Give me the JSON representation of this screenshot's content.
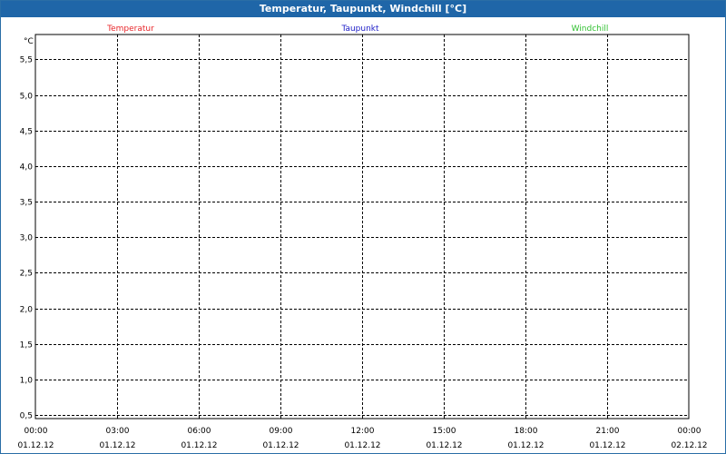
{
  "window": {
    "title": "Temperatur, Taupunkt, Windchill [°C]"
  },
  "chart_data": {
    "type": "line",
    "title": "Temperatur, Taupunkt, Windchill [°C]",
    "xlabel": "",
    "ylabel": "°C",
    "ylim": [
      0.45,
      5.85
    ],
    "grid": true,
    "legend_position": "top",
    "y_ticks": [
      "0,5",
      "1,0",
      "1,5",
      "2,0",
      "2,5",
      "3,0",
      "3,5",
      "4,0",
      "4,5",
      "5,0",
      "5,5"
    ],
    "x_ticks": [
      {
        "time": "00:00",
        "date": "01.12.12"
      },
      {
        "time": "03:00",
        "date": "01.12.12"
      },
      {
        "time": "06:00",
        "date": "01.12.12"
      },
      {
        "time": "09:00",
        "date": "01.12.12"
      },
      {
        "time": "12:00",
        "date": "01.12.12"
      },
      {
        "time": "15:00",
        "date": "01.12.12"
      },
      {
        "time": "18:00",
        "date": "01.12.12"
      },
      {
        "time": "21:00",
        "date": "01.12.12"
      },
      {
        "time": "00:00",
        "date": "02.12.12"
      }
    ],
    "xlim": [
      "01.12.12 00:00",
      "02.12.12 00:00"
    ],
    "series": [
      {
        "name": "Temperatur",
        "color": "#e8262a",
        "values": []
      },
      {
        "name": "Taupunkt",
        "color": "#2020c8",
        "values": []
      },
      {
        "name": "Windchill",
        "color": "#30c030",
        "values": []
      }
    ]
  }
}
